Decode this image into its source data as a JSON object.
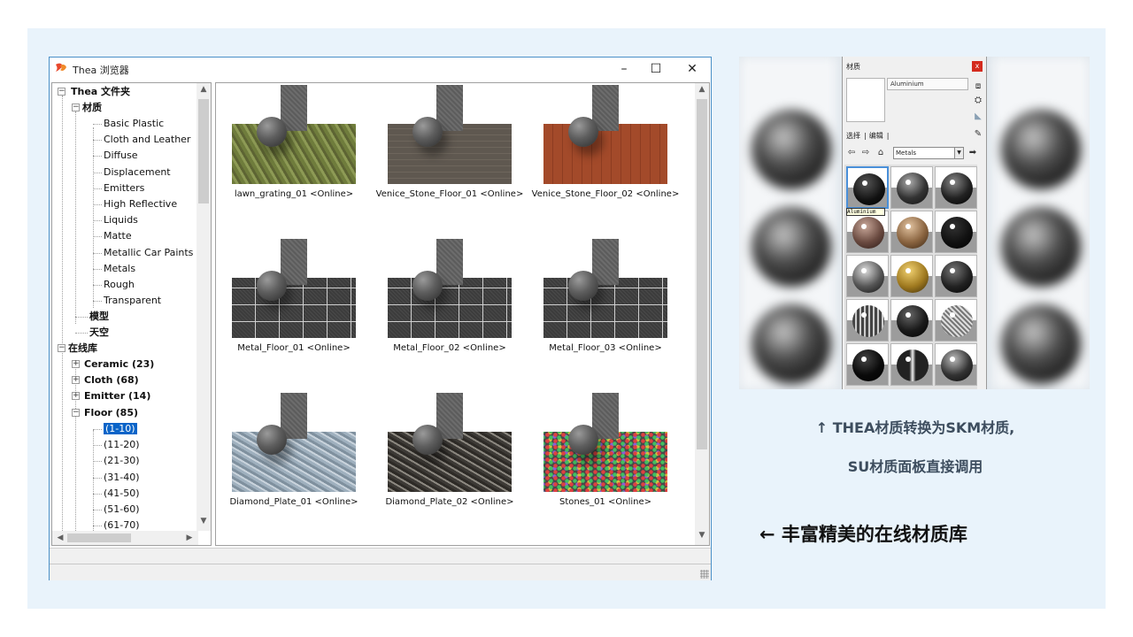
{
  "window": {
    "title": "Thea 浏览器",
    "minimize_glyph": "–",
    "maximize_glyph": "☐",
    "close_glyph": "✕"
  },
  "tree": {
    "root": "Thea 文件夹",
    "materials": "材质",
    "material_items": [
      "Basic Plastic",
      "Cloth and Leather",
      "Diffuse",
      "Displacement",
      "Emitters",
      "High Reflective",
      "Liquids",
      "Matte",
      "Metallic Car Paints",
      "Metals",
      "Rough",
      "Transparent"
    ],
    "models": "模型",
    "sky": "天空",
    "online": "在线库",
    "online_categories": [
      {
        "label": "Ceramic (23)",
        "toggle": "+"
      },
      {
        "label": "Cloth (68)",
        "toggle": "+"
      },
      {
        "label": "Emitter (14)",
        "toggle": "+"
      },
      {
        "label": "Floor (85)",
        "toggle": "−"
      }
    ],
    "floor_pages": [
      "(1-10)",
      "(11-20)",
      "(21-30)",
      "(31-40)",
      "(41-50)",
      "(51-60)",
      "(61-70)"
    ],
    "selected_page": "(1-10)"
  },
  "thumbnails": [
    {
      "label": "lawn_grating_01 <Online>",
      "floor": "lawn"
    },
    {
      "label": "Venice_Stone_Floor_01 <Online>",
      "floor": "stone"
    },
    {
      "label": "Venice_Stone_Floor_02 <Online>",
      "floor": "brick"
    },
    {
      "label": "Metal_Floor_01 <Online>",
      "floor": "metal"
    },
    {
      "label": "Metal_Floor_02 <Online>",
      "floor": "metal"
    },
    {
      "label": "Metal_Floor_03 <Online>",
      "floor": "metal"
    },
    {
      "label": "Diamond_Plate_01 <Online>",
      "floor": "diamond-light"
    },
    {
      "label": "Diamond_Plate_02 <Online>",
      "floor": "diamond-dark"
    },
    {
      "label": "Stones_01 <Online>",
      "floor": "stones"
    }
  ],
  "sketchup_panel": {
    "title": "材质",
    "close_glyph": "x",
    "material_name": "Aluminium",
    "tab_select": "选择",
    "tab_edit": "编辑",
    "library": "Metals",
    "hover_tooltip": "Aluminium"
  },
  "captions": {
    "convert_line1": "↑ THEA材质转换为SKM材质,",
    "convert_line2": "SU材质面板直接调用",
    "online_library": "← 丰富精美的在线材质库"
  },
  "colors": {
    "backdrop": "#e9f3fb",
    "selection": "#0a64c8",
    "caption_dark": "#3d4d5e"
  }
}
